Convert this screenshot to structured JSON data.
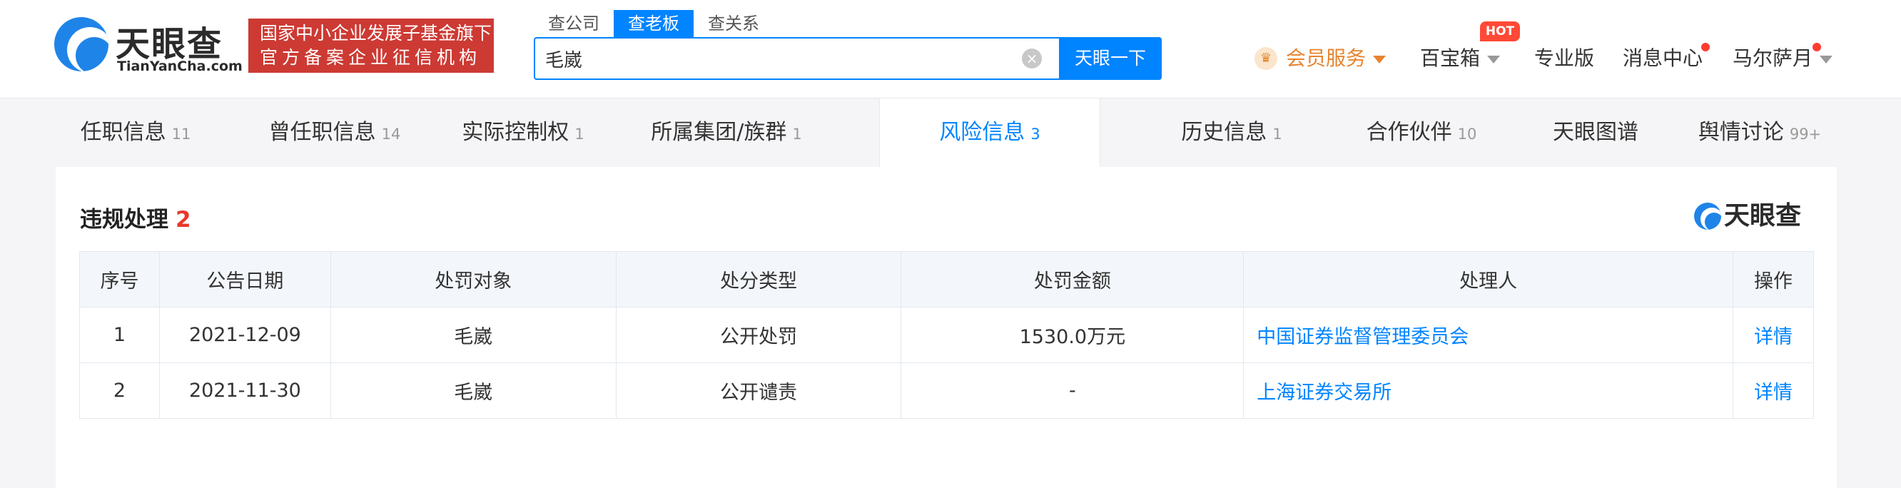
{
  "header": {
    "logo_text": "天眼查",
    "logo_sub": "TianYanCha.com",
    "fund_badge": [
      "国家中小企业发展子基金旗下",
      "官方备案企业征信机构"
    ],
    "search_tabs": [
      "查公司",
      "查老板",
      "查关系"
    ],
    "active_search_tab": "查老板",
    "search_value": "毛崴",
    "search_button": "天眼一下",
    "nav": {
      "vip": "会员服务",
      "baibao": "百宝箱",
      "hot": "HOT",
      "pro": "专业版",
      "messages": "消息中心",
      "user": "马尔萨月"
    },
    "accent_color": "#0084ff",
    "badge_color": "#cc3a33"
  },
  "tabs": [
    {
      "label": "任职信息",
      "count": "11"
    },
    {
      "label": "曾任职信息",
      "count": "14"
    },
    {
      "label": "实际控制权",
      "count": "1"
    },
    {
      "label": "所属集团/族群",
      "count": "1"
    },
    {
      "label": "风险信息",
      "count": "3",
      "active": true
    },
    {
      "label": "历史信息",
      "count": "1"
    },
    {
      "label": "合作伙伴",
      "count": "10"
    },
    {
      "label": "天眼图谱",
      "count": ""
    },
    {
      "label": "舆情讨论",
      "count": "99+"
    }
  ],
  "section": {
    "title": "违规处理",
    "count": "2",
    "brand": "天眼查",
    "columns": [
      "序号",
      "公告日期",
      "处罚对象",
      "处分类型",
      "处罚金额",
      "处理人",
      "操作"
    ],
    "rows": [
      {
        "no": "1",
        "date": "2021-12-09",
        "target": "毛崴",
        "type": "公开处罚",
        "amount": "1530.0万元",
        "handler": "中国证券监督管理委员会",
        "action": "详情"
      },
      {
        "no": "2",
        "date": "2021-11-30",
        "target": "毛崴",
        "type": "公开谴责",
        "amount": "-",
        "handler": "上海证券交易所",
        "action": "详情"
      }
    ]
  }
}
